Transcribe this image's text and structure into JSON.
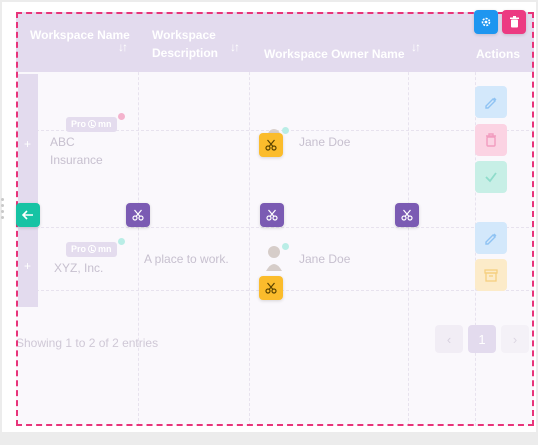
{
  "table": {
    "headers": [
      {
        "label": "Workspace Name",
        "sort": "↓↑"
      },
      {
        "label": "Workspace Description",
        "sort": "↓↑"
      },
      {
        "label": "Workspace Owner Name",
        "sort": "↓↑"
      },
      {
        "label": "Actions"
      }
    ],
    "rows": [
      {
        "expander": "+",
        "name": "ABC Insurance",
        "badge": {
          "prefix": "Pro",
          "suffix": "mn"
        },
        "description": "",
        "owner": "Jane Doe"
      },
      {
        "expander": "+",
        "name": "XYZ, Inc.",
        "badge": {
          "prefix": "Pro",
          "suffix": "mn"
        },
        "description": "A place to work.",
        "owner": "Jane Doe"
      }
    ]
  },
  "footer": {
    "entries_text": "Showing 1 to 2 of 2 entries",
    "pagination": {
      "prev": "‹",
      "current": "1",
      "next": "›"
    }
  },
  "icons": {
    "settings": "gear-icon",
    "delete": "trash-icon",
    "cut": "scissors-icon",
    "back": "arrow-left-icon",
    "edit": "edit-icon",
    "check": "check-icon",
    "archive": "archive-icon"
  },
  "colors": {
    "selection_border": "#e8347a",
    "header_bg": "#e3dbee",
    "tool_purple": "#7b5bb3",
    "tool_yellow": "#fbbc2c",
    "tool_blue": "#1e96f0",
    "tool_pink": "#ec3a82",
    "tool_teal": "#17c3a4"
  }
}
